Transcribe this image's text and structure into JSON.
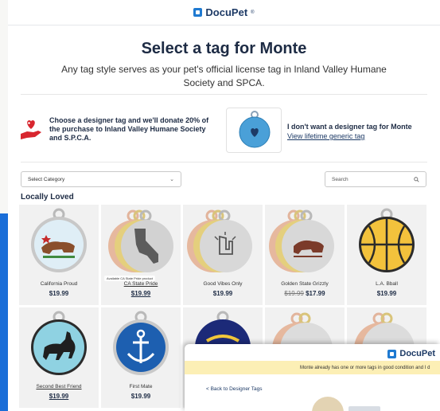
{
  "app": {
    "brand": "DocuPet",
    "brand_mark": "®"
  },
  "header": {
    "title": "Select a tag for Monte",
    "subtitle": "Any tag style serves as your pet's official license tag in Inland Valley Humane Society and SPCA."
  },
  "donation": {
    "text": "Choose a designer tag and we'll donate 20% of the purchase to Inland Valley Humane Society and S.P.C.A."
  },
  "generic": {
    "title": "I don't want a designer tag for Monte",
    "link": "View lifetime generic tag"
  },
  "filters": {
    "category_label": "Select Category",
    "search_placeholder": "Search"
  },
  "section": {
    "heading": "Locally Loved"
  },
  "products": [
    {
      "name": "California Proud",
      "price": "$19.99",
      "underline": false
    },
    {
      "name": "CA State Pride",
      "price": "$19.99",
      "underline": true,
      "badge": "Available CA State Pride product"
    },
    {
      "name": "Good Vibes Only",
      "price": "$19.99",
      "underline": false
    },
    {
      "name": "Golden State Grizzly",
      "old_price": "$19.99",
      "price": "$17.99",
      "underline": false
    },
    {
      "name": "L.A. Bball",
      "price": "$19.99",
      "underline": false
    },
    {
      "name": "Second Best Friend",
      "price": "$19.99",
      "underline": true
    },
    {
      "name": "First Mate",
      "price": "$19.99",
      "underline": false
    },
    {
      "name": "",
      "price": "",
      "underline": false
    },
    {
      "name": "",
      "price": "",
      "underline": false
    },
    {
      "name": "",
      "price": "",
      "underline": false
    }
  ],
  "overlay": {
    "brand": "DocuPet",
    "banner": "Monte already has one or more tags in good condition and I d",
    "back_link": "< Back to Designer Tags"
  },
  "colors": {
    "accent": "#1a6ed8",
    "brand": "#1d3a66",
    "banner": "#fcefb5"
  }
}
